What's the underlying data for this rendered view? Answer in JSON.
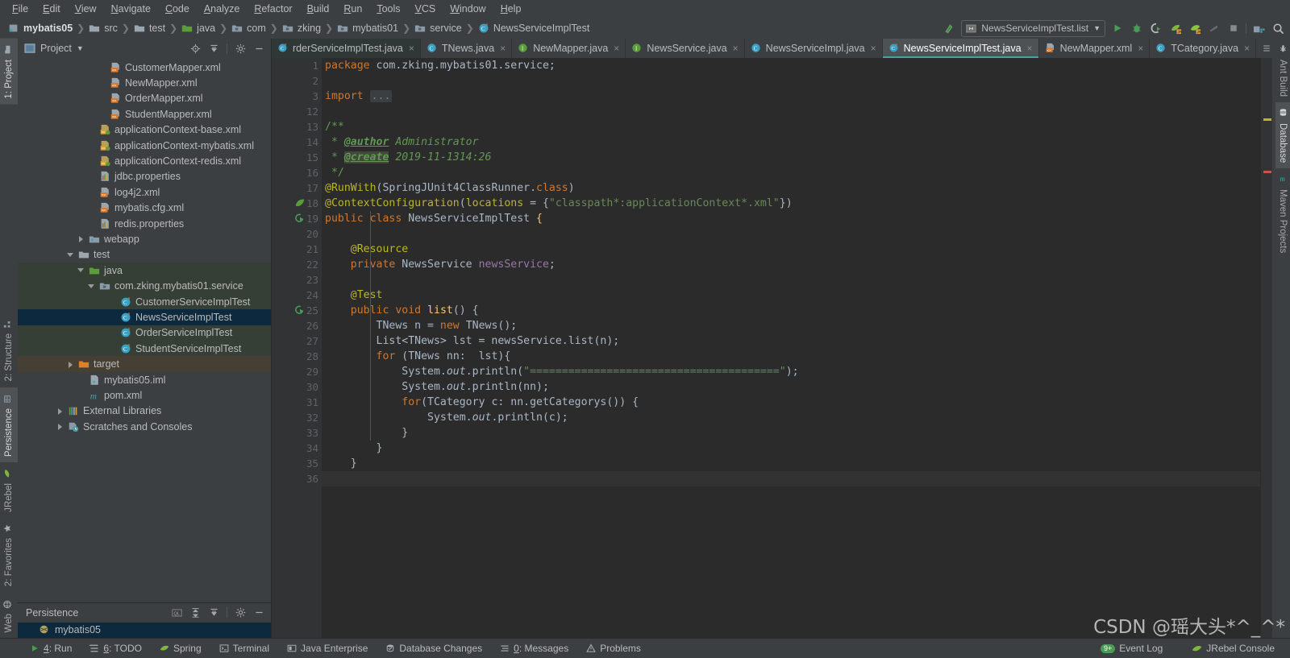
{
  "menubar": {
    "items": [
      "File",
      "Edit",
      "View",
      "Navigate",
      "Code",
      "Analyze",
      "Refactor",
      "Build",
      "Run",
      "Tools",
      "VCS",
      "Window",
      "Help"
    ]
  },
  "breadcrumb": {
    "items": [
      {
        "label": "mybatis05",
        "icon": "module-icon",
        "bold": true
      },
      {
        "label": "src",
        "icon": "folder-icon"
      },
      {
        "label": "test",
        "icon": "folder-icon"
      },
      {
        "label": "java",
        "icon": "source-folder-green-icon"
      },
      {
        "label": "com",
        "icon": "package-icon"
      },
      {
        "label": "zking",
        "icon": "package-icon"
      },
      {
        "label": "mybatis01",
        "icon": "package-icon"
      },
      {
        "label": "service",
        "icon": "package-icon"
      },
      {
        "label": "NewsServiceImplTest",
        "icon": "test-class-icon"
      }
    ]
  },
  "toolbar": {
    "run_config": "NewsServiceImplTest.list",
    "icons": [
      "build-icon",
      "run-icon",
      "debug-icon",
      "run-coverage-icon",
      "jrebel-run-icon",
      "jrebel-debug-icon",
      "stop-gray-icon",
      "stop-icon",
      "project-structure-icon",
      "search-icon"
    ]
  },
  "project_panel": {
    "title": "Project",
    "actions": [
      "locate-icon",
      "collapse-all-icon",
      "settings-gear-icon",
      "hide-icon"
    ],
    "tree": [
      {
        "label": "CustomerMapper.xml",
        "icon": "xml-mapper-icon",
        "indent": 7,
        "arrow": "none",
        "bg": "none"
      },
      {
        "label": "NewMapper.xml",
        "icon": "xml-mapper-icon",
        "indent": 7,
        "arrow": "none",
        "bg": "none"
      },
      {
        "label": "OrderMapper.xml",
        "icon": "xml-mapper-icon",
        "indent": 7,
        "arrow": "none",
        "bg": "none"
      },
      {
        "label": "StudentMapper.xml",
        "icon": "xml-mapper-icon",
        "indent": 7,
        "arrow": "none",
        "bg": "none"
      },
      {
        "label": "applicationContext-base.xml",
        "icon": "xml-spring-icon",
        "indent": 6,
        "arrow": "none",
        "bg": "none"
      },
      {
        "label": "applicationContext-mybatis.xml",
        "icon": "xml-spring-icon",
        "indent": 6,
        "arrow": "none",
        "bg": "none"
      },
      {
        "label": "applicationContext-redis.xml",
        "icon": "xml-spring-icon",
        "indent": 6,
        "arrow": "none",
        "bg": "none"
      },
      {
        "label": "jdbc.properties",
        "icon": "properties-icon",
        "indent": 6,
        "arrow": "none",
        "bg": "none"
      },
      {
        "label": "log4j2.xml",
        "icon": "xml-icon",
        "indent": 6,
        "arrow": "none",
        "bg": "none"
      },
      {
        "label": "mybatis.cfg.xml",
        "icon": "xml-icon",
        "indent": 6,
        "arrow": "none",
        "bg": "none"
      },
      {
        "label": "redis.properties",
        "icon": "properties-icon",
        "indent": 6,
        "arrow": "none",
        "bg": "none"
      },
      {
        "label": "webapp",
        "icon": "web-folder-icon",
        "indent": 5,
        "arrow": "right",
        "bg": "none"
      },
      {
        "label": "test",
        "icon": "folder-icon",
        "indent": 4,
        "arrow": "down",
        "bg": "none"
      },
      {
        "label": "java",
        "icon": "source-folder-green-icon",
        "indent": 5,
        "arrow": "down",
        "bg": "green"
      },
      {
        "label": "com.zking.mybatis01.service",
        "icon": "package-icon",
        "indent": 6,
        "arrow": "down",
        "bg": "green"
      },
      {
        "label": "CustomerServiceImplTest",
        "icon": "test-class-icon",
        "indent": 8,
        "arrow": "none",
        "bg": "green"
      },
      {
        "label": "NewsServiceImplTest",
        "icon": "test-class-icon",
        "indent": 8,
        "arrow": "none",
        "bg": "selected"
      },
      {
        "label": "OrderServiceImplTest",
        "icon": "test-class-icon",
        "indent": 8,
        "arrow": "none",
        "bg": "green"
      },
      {
        "label": "StudentServiceImplTest",
        "icon": "test-class-icon",
        "indent": 8,
        "arrow": "none",
        "bg": "green"
      },
      {
        "label": "target",
        "icon": "target-folder-icon",
        "indent": 4,
        "arrow": "right",
        "bg": "orange"
      },
      {
        "label": "mybatis05.iml",
        "icon": "iml-icon",
        "indent": 5,
        "arrow": "none",
        "bg": "none"
      },
      {
        "label": "pom.xml",
        "icon": "maven-icon",
        "indent": 5,
        "arrow": "none",
        "bg": "none"
      },
      {
        "label": "External Libraries",
        "icon": "libraries-icon",
        "indent": 3,
        "arrow": "right",
        "bg": "none"
      },
      {
        "label": "Scratches and Consoles",
        "icon": "scratches-icon",
        "indent": 3,
        "arrow": "right",
        "bg": "none"
      }
    ]
  },
  "persistence_panel": {
    "title": "Persistence",
    "actions": [
      "sql-icon",
      "expand-icon",
      "collapse-icon",
      "settings-gear-icon",
      "hide-icon"
    ],
    "items": [
      {
        "label": "mybatis05",
        "icon": "datasource-icon",
        "selected": true
      }
    ]
  },
  "editor_tabs": {
    "tabs": [
      {
        "label": "rderServiceImplTest.java",
        "icon": "test-class-icon",
        "active": false,
        "clipped": true
      },
      {
        "label": "TNews.java",
        "icon": "class-icon",
        "active": false
      },
      {
        "label": "NewMapper.java",
        "icon": "interface-icon",
        "active": false
      },
      {
        "label": "NewsService.java",
        "icon": "interface-icon",
        "active": false
      },
      {
        "label": "NewsServiceImpl.java",
        "icon": "class-icon",
        "active": false
      },
      {
        "label": "NewsServiceImplTest.java",
        "icon": "test-class-icon",
        "active": true
      },
      {
        "label": "NewMapper.xml",
        "icon": "xml-mapper-icon",
        "active": false
      },
      {
        "label": "TCategory.java",
        "icon": "class-icon",
        "active": false
      }
    ],
    "close_label": "×"
  },
  "editor": {
    "filename": "NewsServiceImplTest.java",
    "lines": [
      {
        "num": "1",
        "text": "package com.zking.mybatis01.service;"
      },
      {
        "num": "2",
        "text": ""
      },
      {
        "num": "3",
        "text": "import ..."
      },
      {
        "num": "12",
        "text": ""
      },
      {
        "num": "13",
        "text": "/**"
      },
      {
        "num": "14",
        "text": " * @author Administrator"
      },
      {
        "num": "15",
        "text": " * @create 2019-11-1314:26"
      },
      {
        "num": "16",
        "text": " */"
      },
      {
        "num": "17",
        "text": "@RunWith(SpringJUnit4ClassRunner.class)"
      },
      {
        "num": "18",
        "text": "@ContextConfiguration(locations = {\"classpath*:applicationContext*.xml\"})"
      },
      {
        "num": "19",
        "text": "public class NewsServiceImplTest {"
      },
      {
        "num": "20",
        "text": ""
      },
      {
        "num": "21",
        "text": "    @Resource"
      },
      {
        "num": "22",
        "text": "    private NewsService newsService;"
      },
      {
        "num": "23",
        "text": ""
      },
      {
        "num": "24",
        "text": "    @Test"
      },
      {
        "num": "25",
        "text": "    public void list() {"
      },
      {
        "num": "26",
        "text": "        TNews n = new TNews();"
      },
      {
        "num": "27",
        "text": "        List<TNews> lst = newsService.list(n);"
      },
      {
        "num": "28",
        "text": "        for (TNews nn:  lst){"
      },
      {
        "num": "29",
        "text": "            System.out.println(\"=======================================\");"
      },
      {
        "num": "30",
        "text": "            System.out.println(nn);"
      },
      {
        "num": "31",
        "text": "            for(TCategory c: nn.getCategorys()) {"
      },
      {
        "num": "32",
        "text": "                System.out.println(c);"
      },
      {
        "num": "33",
        "text": "            }"
      },
      {
        "num": "34",
        "text": "        }"
      },
      {
        "num": "35",
        "text": "    }"
      },
      {
        "num": "36",
        "text": "}"
      }
    ],
    "gutter_icons": [
      {
        "line": 18,
        "icon": "spring-bean-icon"
      },
      {
        "line": 19,
        "icon": "run-test-icon"
      },
      {
        "line": 25,
        "icon": "run-test-icon"
      }
    ]
  },
  "left_rail": {
    "items": [
      {
        "label": "1: Project",
        "icon": "project-icon",
        "selected": true
      },
      {
        "label": "2: Structure",
        "icon": "structure-icon",
        "selected": false
      },
      {
        "label": "Persistence",
        "icon": "persistence-icon",
        "selected": true
      },
      {
        "label": "JRebel",
        "icon": "jrebel-icon",
        "selected": false
      },
      {
        "label": "2: Favorites",
        "icon": "star-icon",
        "selected": false
      },
      {
        "label": "Web",
        "icon": "web-icon",
        "selected": false
      }
    ]
  },
  "right_rail": {
    "items": [
      {
        "label": "Ant Build",
        "icon": "ant-icon",
        "selected": false
      },
      {
        "label": "Database",
        "icon": "database-icon",
        "selected": true
      },
      {
        "label": "Maven Projects",
        "icon": "maven-icon",
        "selected": false
      }
    ]
  },
  "statusbar": {
    "items": [
      {
        "label": "4: Run",
        "icon": "run-icon",
        "underline": "4"
      },
      {
        "label": "6: TODO",
        "icon": "todo-icon",
        "underline": "6"
      },
      {
        "label": "Spring",
        "icon": "spring-icon",
        "underline": ""
      },
      {
        "label": "Terminal",
        "icon": "terminal-icon",
        "underline": ""
      },
      {
        "label": "Java Enterprise",
        "icon": "java-ee-icon",
        "underline": ""
      },
      {
        "label": "Database Changes",
        "icon": "db-changes-icon",
        "underline": ""
      },
      {
        "label": "0: Messages",
        "icon": "messages-icon",
        "underline": "0"
      },
      {
        "label": "Problems",
        "icon": "problems-icon",
        "underline": ""
      }
    ],
    "right_items": [
      {
        "label": "Event Log",
        "icon": "event-log-icon",
        "badge": "9+"
      },
      {
        "label": "JRebel Console",
        "icon": "jrebel-icon",
        "badge": ""
      }
    ]
  },
  "watermark": {
    "text": "CSDN @瑶大头*^_^*"
  },
  "colors": {
    "accent_teal": "#4a9ea8",
    "panel_bg": "#3c3f41",
    "editor_bg": "#2b2b2b",
    "selection_blue": "#0d293e",
    "keyword_orange": "#cc7832",
    "string_green": "#6a8759",
    "comment_green": "#629755",
    "annotation_yellow": "#bbb529",
    "field_purple": "#9876aa",
    "method_gold": "#ffc66d"
  }
}
